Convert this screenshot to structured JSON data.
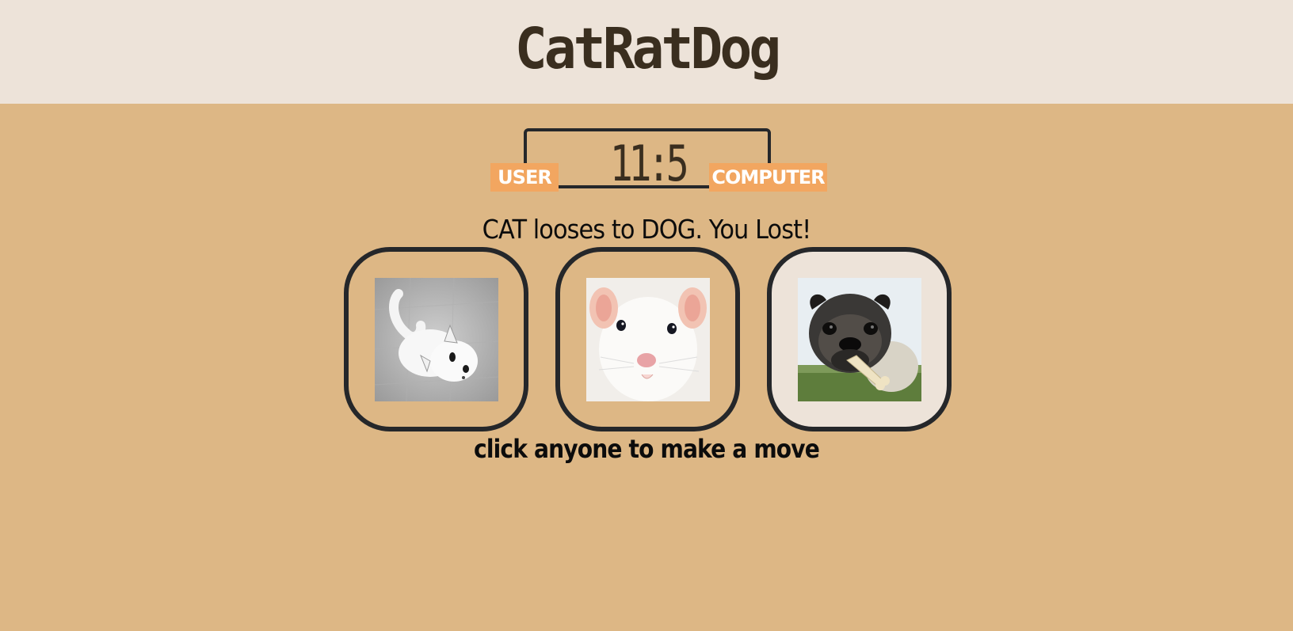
{
  "header": {
    "title": "CatRatDog",
    "background": "#ede3d9"
  },
  "scoreboard": {
    "score": "11:5",
    "user_label": "USER",
    "computer_label": "COMPUTER",
    "badge_color": "#f2a660"
  },
  "result": {
    "message": "CAT looses to DOG. You Lost!"
  },
  "choices": [
    {
      "name": "cat",
      "icon": "cat-photo",
      "selected": false
    },
    {
      "name": "rat",
      "icon": "rat-photo",
      "selected": false
    },
    {
      "name": "dog",
      "icon": "dog-photo",
      "selected": true
    }
  ],
  "hint": {
    "text": "click anyone to make a move"
  },
  "colors": {
    "page_background": "#ddb785",
    "border": "#25272a",
    "selected_choice_background": "#ede3d9"
  }
}
